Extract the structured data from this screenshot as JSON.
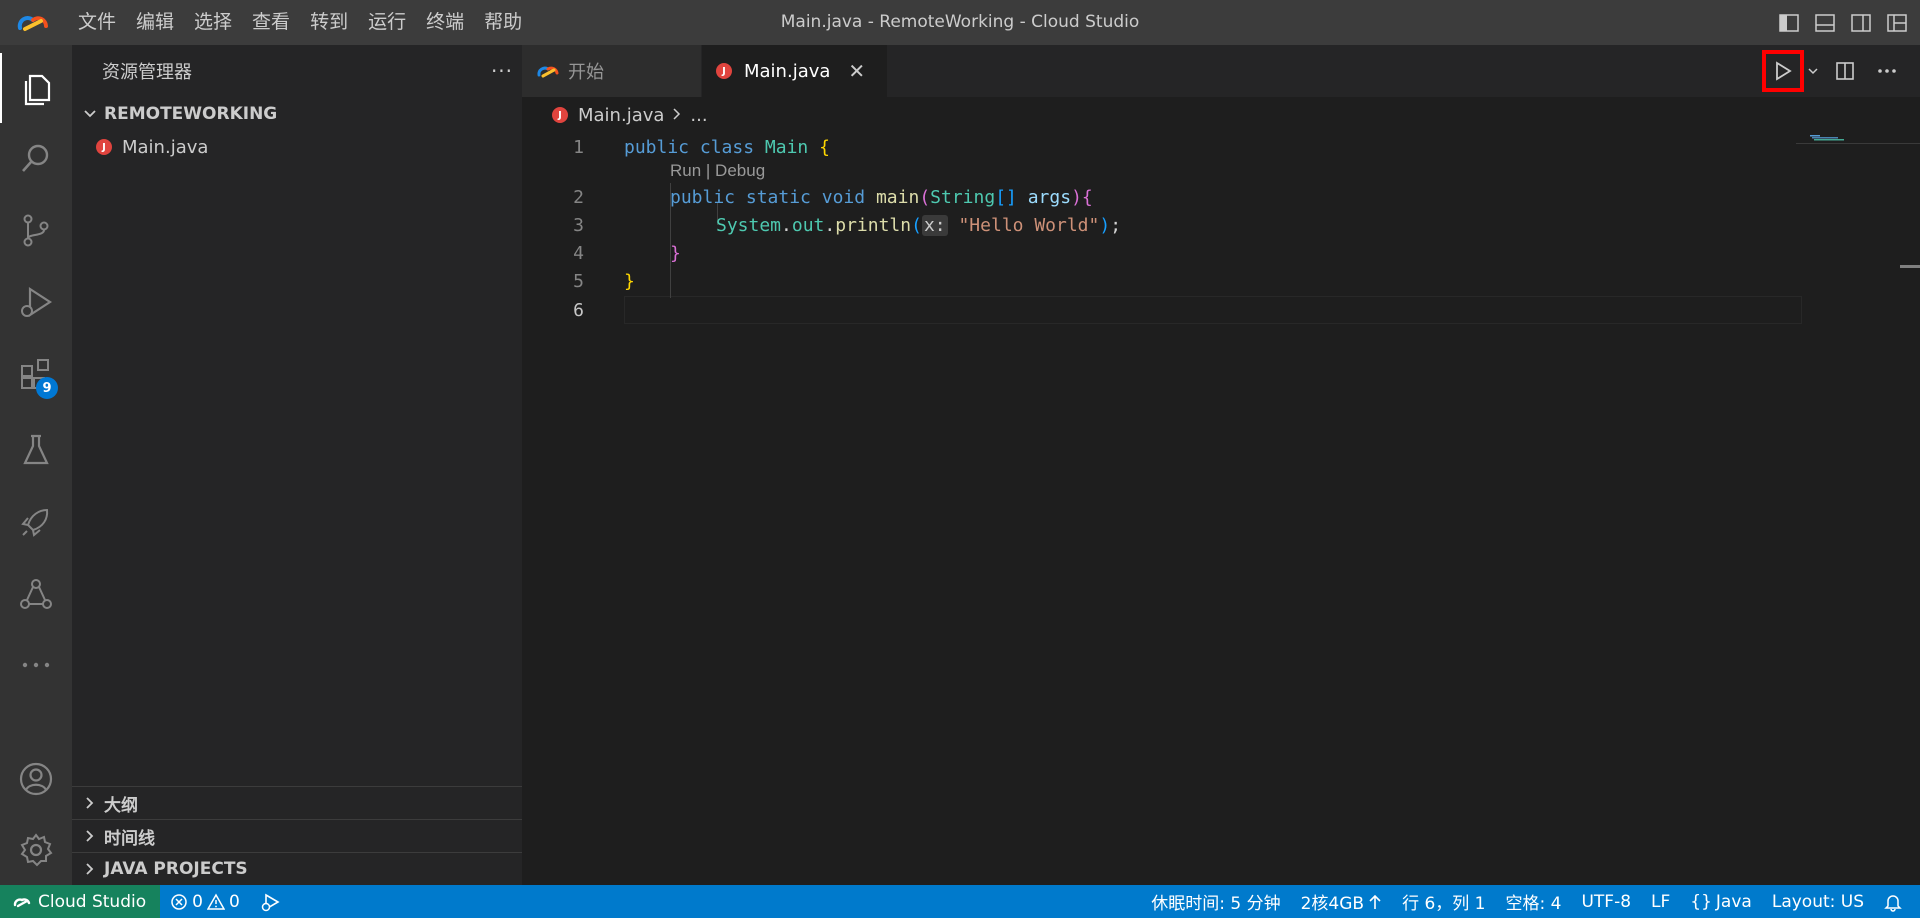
{
  "window": {
    "title": "Main.java - RemoteWorking - Cloud Studio"
  },
  "menu": [
    "文件",
    "编辑",
    "选择",
    "查看",
    "转到",
    "运行",
    "终端",
    "帮助"
  ],
  "activity": {
    "extensions_badge": "9"
  },
  "sidebar": {
    "title": "资源管理器",
    "more": "···",
    "folder": "REMOTEWORKING",
    "files": [
      {
        "name": "Main.java",
        "icon": "java-icon"
      }
    ],
    "sections": [
      "大纲",
      "时间线",
      "JAVA PROJECTS"
    ]
  },
  "tabs": [
    {
      "label": "开始",
      "active": false
    },
    {
      "label": "Main.java",
      "active": true,
      "close": "✕"
    }
  ],
  "breadcrumb": {
    "file": "Main.java",
    "tail": "..."
  },
  "editor": {
    "line_numbers": [
      "1",
      "2",
      "3",
      "4",
      "5",
      "6"
    ],
    "codelens": "Run | Debug",
    "lines": {
      "l1": {
        "kw1": "public",
        "kw2": "class",
        "name": "Main",
        "brace": "{"
      },
      "l2": {
        "kw1": "public",
        "kw2": "static",
        "kw3": "void",
        "fn": "main",
        "p1": "(",
        "ty": "String",
        "arr": "[]",
        "arg": "args",
        "p2": ")",
        "brace": "{"
      },
      "l3": {
        "ty": "System",
        "dot1": ".",
        "var": "out",
        "dot2": ".",
        "fn": "println",
        "p1": "(",
        "hint": "x:",
        "str": "\"Hello World\"",
        "p2": ")",
        "semi": ";"
      },
      "l4": {
        "brace": "}"
      },
      "l5": {
        "brace": "}"
      }
    }
  },
  "statusbar": {
    "remote": "Cloud Studio",
    "errors": "0",
    "warnings": "0",
    "sleep": "休眠时间: 5 分钟",
    "spec": "2核4GB",
    "position": "行 6，列 1",
    "spaces": "空格: 4",
    "encoding": "UTF-8",
    "eol": "LF",
    "language": "Java",
    "layout": "Layout: US"
  },
  "colors": {
    "statusbar": "#007acc",
    "remote": "#16825d",
    "run_highlight": "#ff0000"
  }
}
